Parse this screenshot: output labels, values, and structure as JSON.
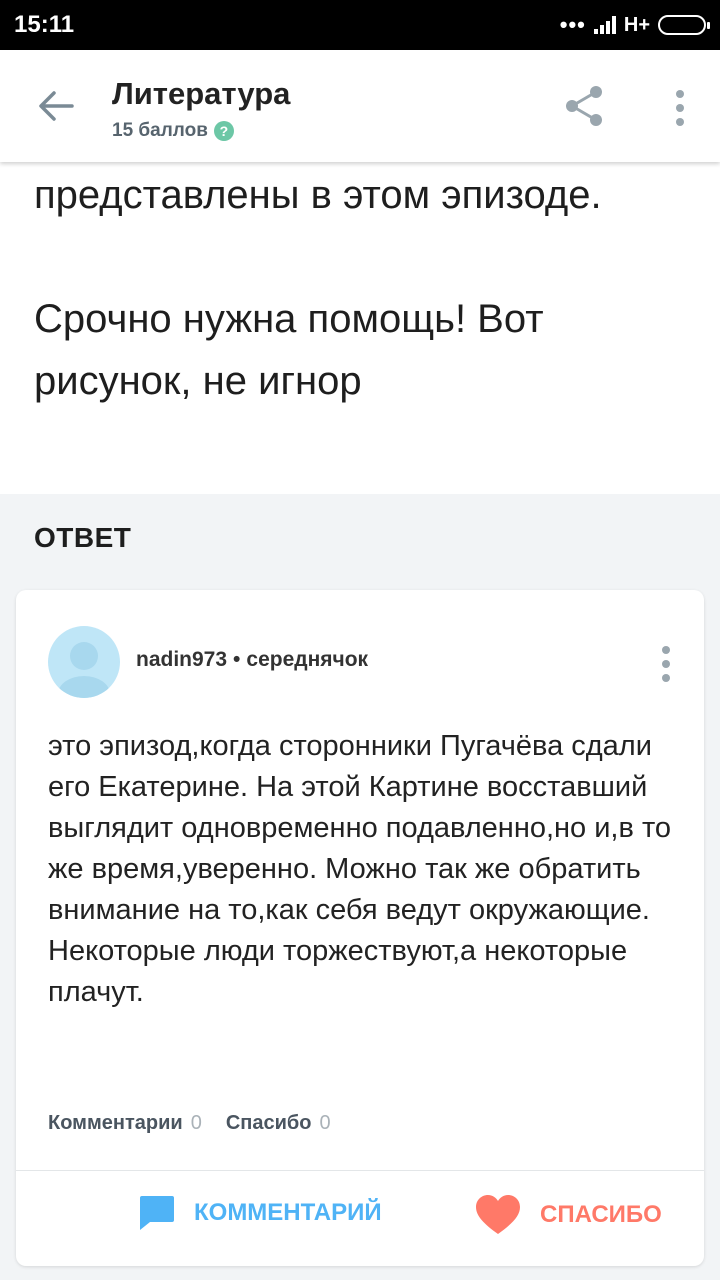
{
  "status_bar": {
    "time": "15:11",
    "network": "H+",
    "icons": [
      "dots-icon",
      "signal-icon",
      "battery-icon"
    ]
  },
  "header": {
    "title": "Литература",
    "points": "15 баллов",
    "help_glyph": "?",
    "icons": [
      "back-arrow-icon",
      "share-icon",
      "more-vertical-icon"
    ]
  },
  "question": {
    "paragraphs": [
      "представлены в этом эпизоде.",
      "Срочно нужна помощь! Вот рисунок, не игнор"
    ]
  },
  "answer": {
    "heading": "ОТВЕТ",
    "author": "nadin973",
    "separator": "•",
    "rank": "середнячок",
    "text": "это эпизод,когда сторонники Пугачёва сдали его Екатерине. На этой Картине восставший выглядит одновременно подавленно,но и,в то же время,уверенно. Можно так же обратить внимание на то,как себя ведут окружающие. Некоторые люди торжествуют,а некоторые плачут.",
    "comments_label": "Комментарии",
    "comments_count": "0",
    "thanks_label": "Спасибо",
    "thanks_count": "0",
    "comment_button": "КОММЕНТАРИЙ",
    "thanks_button": "СПАСИБО"
  },
  "colors": {
    "accent_blue": "#4fb3f6",
    "accent_red": "#ff7968",
    "help_green": "#6cc7a6",
    "avatar_bg": "#bfe6f7"
  }
}
